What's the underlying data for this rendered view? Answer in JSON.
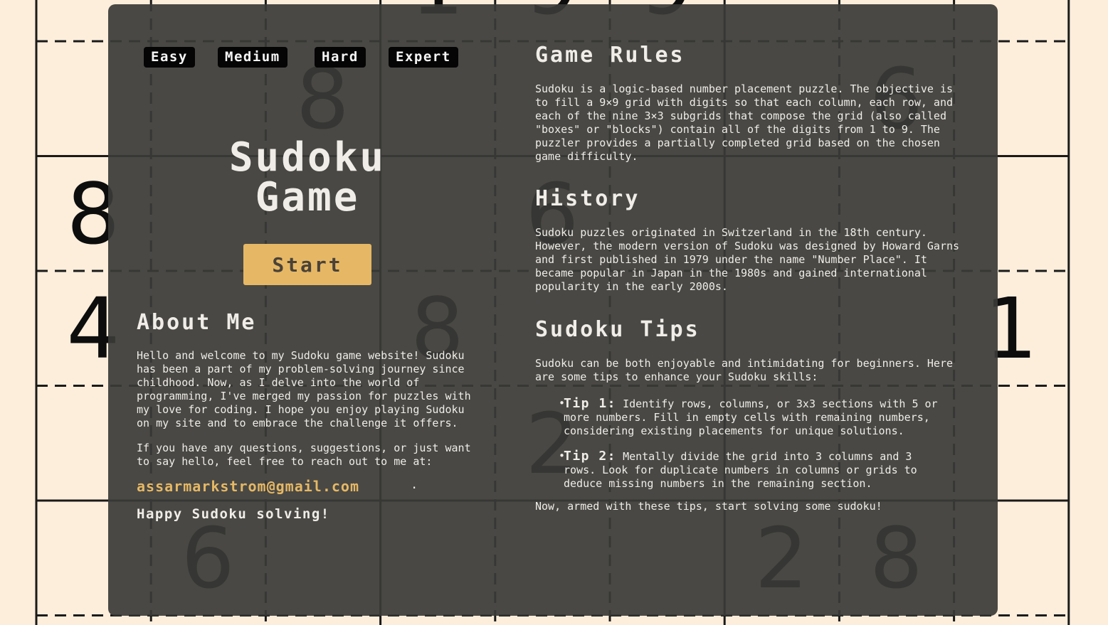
{
  "difficulty": {
    "easy": "Easy",
    "medium": "Medium",
    "hard": "Hard",
    "expert": "Expert"
  },
  "hero": {
    "title_line1": "Sudoku",
    "title_line2": "Game",
    "start_label": "Start"
  },
  "about": {
    "heading": "About Me",
    "paragraph1": "Hello and welcome to my Sudoku game website! Sudoku has been a part of my problem-solving journey since childhood. Now, as I delve into the world of programming, I've merged my passion for puzzles with my love for coding. I hope you enjoy playing Sudoku on my site and to embrace the challenge it offers.",
    "paragraph2": "If you have any questions, suggestions, or just want to say hello, feel free to reach out to me at:",
    "email": "assarmarkstrom@gmail.com",
    "email_suffix": ".",
    "signoff": "Happy Sudoku solving!"
  },
  "rules": {
    "heading": "Game Rules",
    "text": "Sudoku is a logic-based number placement puzzle. The objective is to fill a 9×9 grid with digits so that each column, each row, and each of the nine 3×3 subgrids that compose the grid (also called \"boxes\" or \"blocks\") contain all of the digits from 1 to 9. The puzzler provides a partially completed grid based on the chosen game difficulty."
  },
  "history": {
    "heading": "History",
    "text": "Sudoku puzzles originated in Switzerland in the 18th century. However, the modern version of Sudoku was designed by Howard Garns and first published in 1979 under the name \"Number Place\". It became popular in Japan in the 1980s and gained international popularity in the early 2000s."
  },
  "tips": {
    "heading": "Sudoku Tips",
    "intro": "Sudoku can be both enjoyable and intimidating for beginners. Here are some tips to enhance your Sudoku skills:",
    "items": [
      {
        "label": "Tip 1:",
        "text": "Identify rows, columns, or 3x3 sections with 5 or more numbers. Fill in empty cells with remaining numbers, considering existing placements for unique solutions."
      },
      {
        "label": "Tip 2:",
        "text": "Mentally divide the grid into 3 columns and 3 rows. Look for duplicate numbers in columns or grids to deduce missing numbers in the remaining section."
      }
    ],
    "outro": "Now, armed with these tips, start solving some sudoku!"
  },
  "background_board": {
    "digits": [
      {
        "row": 0,
        "col": 3,
        "value": "1"
      },
      {
        "row": 0,
        "col": 4,
        "value": "9"
      },
      {
        "row": 0,
        "col": 5,
        "value": "9"
      },
      {
        "row": 1,
        "col": 2,
        "value": "8"
      },
      {
        "row": 1,
        "col": 7,
        "value": "6"
      },
      {
        "row": 2,
        "col": 0,
        "value": "8"
      },
      {
        "row": 2,
        "col": 4,
        "value": "6"
      },
      {
        "row": 3,
        "col": 0,
        "value": "4"
      },
      {
        "row": 3,
        "col": 3,
        "value": "8"
      },
      {
        "row": 3,
        "col": 8,
        "value": "1"
      },
      {
        "row": 4,
        "col": 4,
        "value": "2"
      },
      {
        "row": 5,
        "col": 1,
        "value": "6"
      },
      {
        "row": 5,
        "col": 6,
        "value": "2"
      },
      {
        "row": 5,
        "col": 7,
        "value": "8"
      }
    ]
  },
  "colors": {
    "page_background": "#fdeedb",
    "panel_background": "#3a3937",
    "accent": "#e6b865",
    "text": "#f0ede8",
    "difficulty_button": "#050505"
  }
}
